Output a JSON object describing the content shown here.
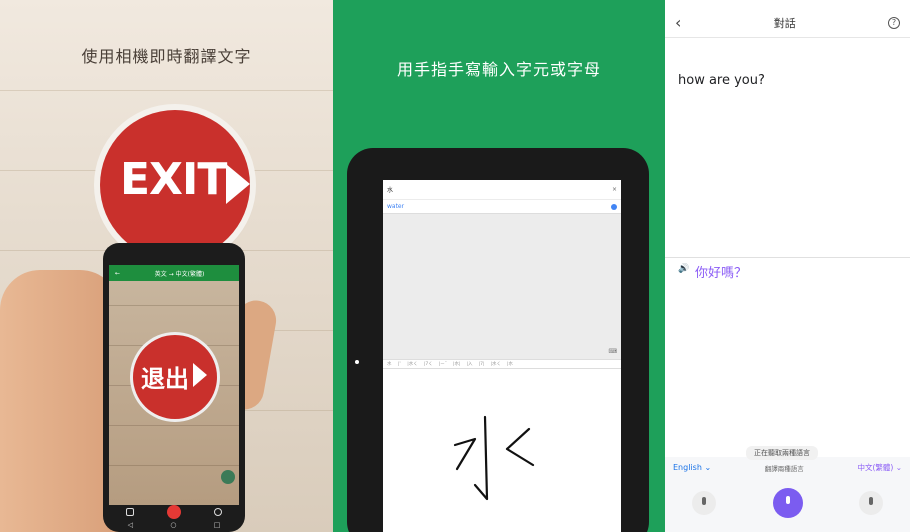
{
  "panels": {
    "camera": {
      "caption": "使用相機即時翻譯文字",
      "sign_text": "EXIT",
      "phone": {
        "lang_from": "英文",
        "lang_arrow": "→",
        "lang_to": "中文(繁體)",
        "back_label": "←",
        "translated_sign": "退出",
        "nav_back": "◁",
        "nav_home": "○",
        "nav_recent": "□"
      }
    },
    "handwriting": {
      "caption": "用手指手寫輸入字元或字母",
      "input_char": "水",
      "close_label": "×",
      "result": "water",
      "keyboard_icon": "⌨",
      "candidates": [
        "水",
        "|˜",
        "|水く",
        "|7く",
        "|ㄧˇ",
        "|水|",
        "|入",
        "|7|",
        "|水く",
        "|水"
      ],
      "handwritten_char": "水"
    },
    "conversation": {
      "title": "對話",
      "back_label": "‹",
      "help_label": "?",
      "source_text": "how are you?",
      "speaker_icon": "🔊",
      "translated_text": "你好嗎？",
      "listening_status": "正在聽取兩種語言",
      "lang_left": "English",
      "lang_mid": "翻譯兩種語言",
      "lang_right": "中文(繁體)",
      "chevron": "⌄"
    }
  },
  "colors": {
    "green_bg": "#1ea05a",
    "sign_red": "#c9302c",
    "accent_purple": "#7b5cf0",
    "link_blue": "#1a73e8"
  }
}
